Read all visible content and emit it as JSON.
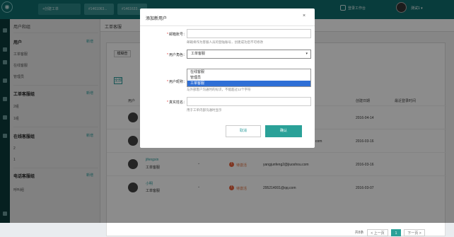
{
  "topbar": {
    "tabs": [
      "+创建工单",
      "#1461063...",
      "#1461633..."
    ],
    "right_text": "登录工作台",
    "user_name": "测试1 ▾"
  },
  "left_panel": {
    "title": "用户和组",
    "groups": [
      {
        "title": "用户",
        "add": "新增",
        "items": [
          "工单客服",
          "在线客服",
          "管理员"
        ]
      },
      {
        "title": "工单客服组",
        "add": "新增",
        "items": [
          "2组",
          "1组"
        ]
      },
      {
        "title": "在线客服组",
        "add": "新增",
        "items": [
          "2",
          "1"
        ]
      },
      {
        "title": "电话客服组",
        "add": "新增",
        "items": [
          "呼叫组"
        ]
      }
    ]
  },
  "main": {
    "title": "工单客服",
    "filter_label": "模糊查",
    "all_label": "全部",
    "headers": [
      "用户",
      "创建日期",
      "最近登录时间"
    ],
    "rows": [
      {
        "name": "",
        "role": "",
        "email": "",
        "date": "2016-04-14",
        "status": ""
      },
      {
        "name": "",
        "role": "",
        "email": "com",
        "date": "2016-03-16",
        "status": ""
      },
      {
        "name": "jifengxin",
        "role": "工单客服",
        "email": "yangjunfeng2@jiuoshou.com",
        "date": "2016-03-16",
        "status": "待激活"
      },
      {
        "name": "小明",
        "role": "工单客服",
        "email": "295214001@qq.com",
        "date": "2016-03-07",
        "status": "待激活"
      }
    ],
    "pager": {
      "total": "共8条",
      "prev": "< 上一页",
      "page": "1",
      "next": "下一页 >"
    }
  },
  "modal": {
    "title": "添加新用户",
    "close": "×",
    "fields": {
      "account_label": "邮箱账号：",
      "account_value": "",
      "account_hint": "邮箱将作为客服人员的登陆账号，创建成功后不可修改",
      "role_label": "用户角色：",
      "role_value": "工单客服",
      "role_options": [
        "在线客服",
        "管理员",
        "工单客服"
      ],
      "nickname_label": "用户昵称：",
      "nickname_hint": "与外部客户沟通时的标识，不能超过12个字符",
      "realname_label": "真实姓名：",
      "realname_value": "",
      "realname_hint": "用于工单内部沟通时显示"
    },
    "cancel": "取消",
    "confirm": "确认"
  },
  "colors": {
    "teal": "#0f6e6e",
    "accent": "#2aa198",
    "selected": "#2f6fd6"
  }
}
